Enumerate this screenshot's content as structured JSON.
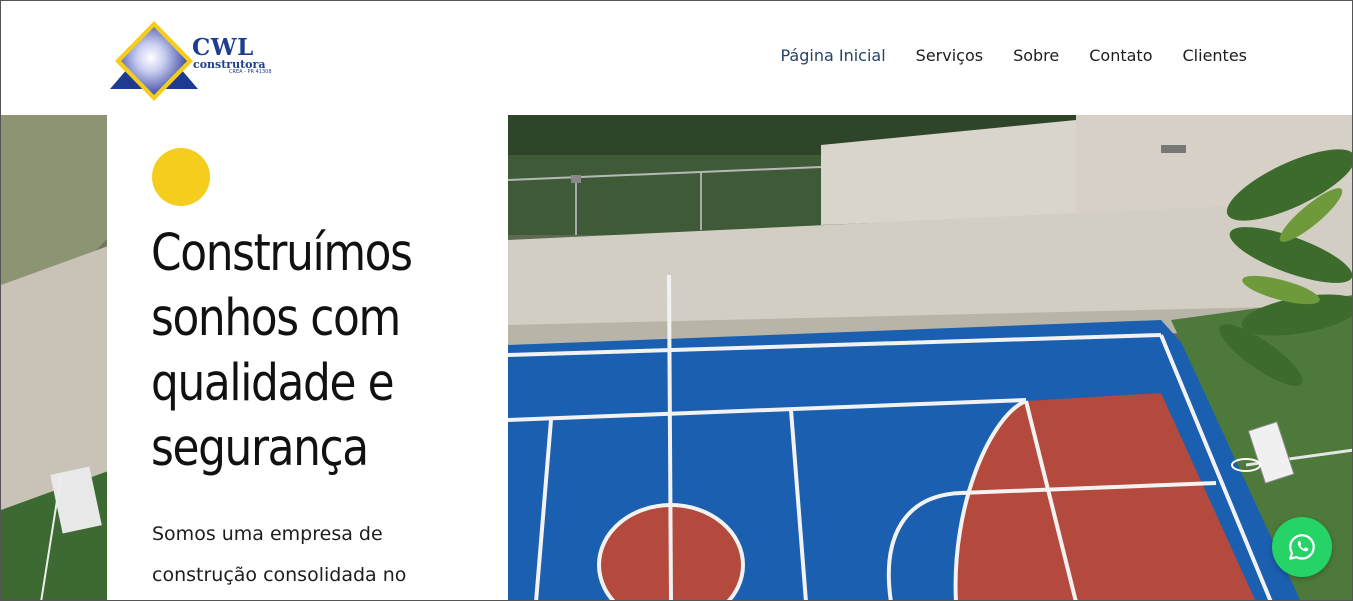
{
  "brand": {
    "name": "CWL",
    "subtitle": "construtora",
    "registry": "CREA - PR 41308",
    "colors": {
      "blue": "#1d3d8f",
      "yellow": "#f5cd1c"
    }
  },
  "nav": {
    "items": [
      {
        "label": "Página Inicial",
        "active": true
      },
      {
        "label": "Serviços",
        "active": false
      },
      {
        "label": "Sobre",
        "active": false
      },
      {
        "label": "Contato",
        "active": false
      },
      {
        "label": "Clientes",
        "active": false
      }
    ],
    "active_color": "#23446b"
  },
  "hero": {
    "title": "Construímos sonhos com qualidade e segurança",
    "text": "Somos uma empresa de construção consolidada no",
    "image_description_icon": "basketball-court-photo",
    "accent_color": "#f5cd1c"
  },
  "whatsapp": {
    "icon": "whatsapp-icon",
    "color": "#25d366"
  }
}
